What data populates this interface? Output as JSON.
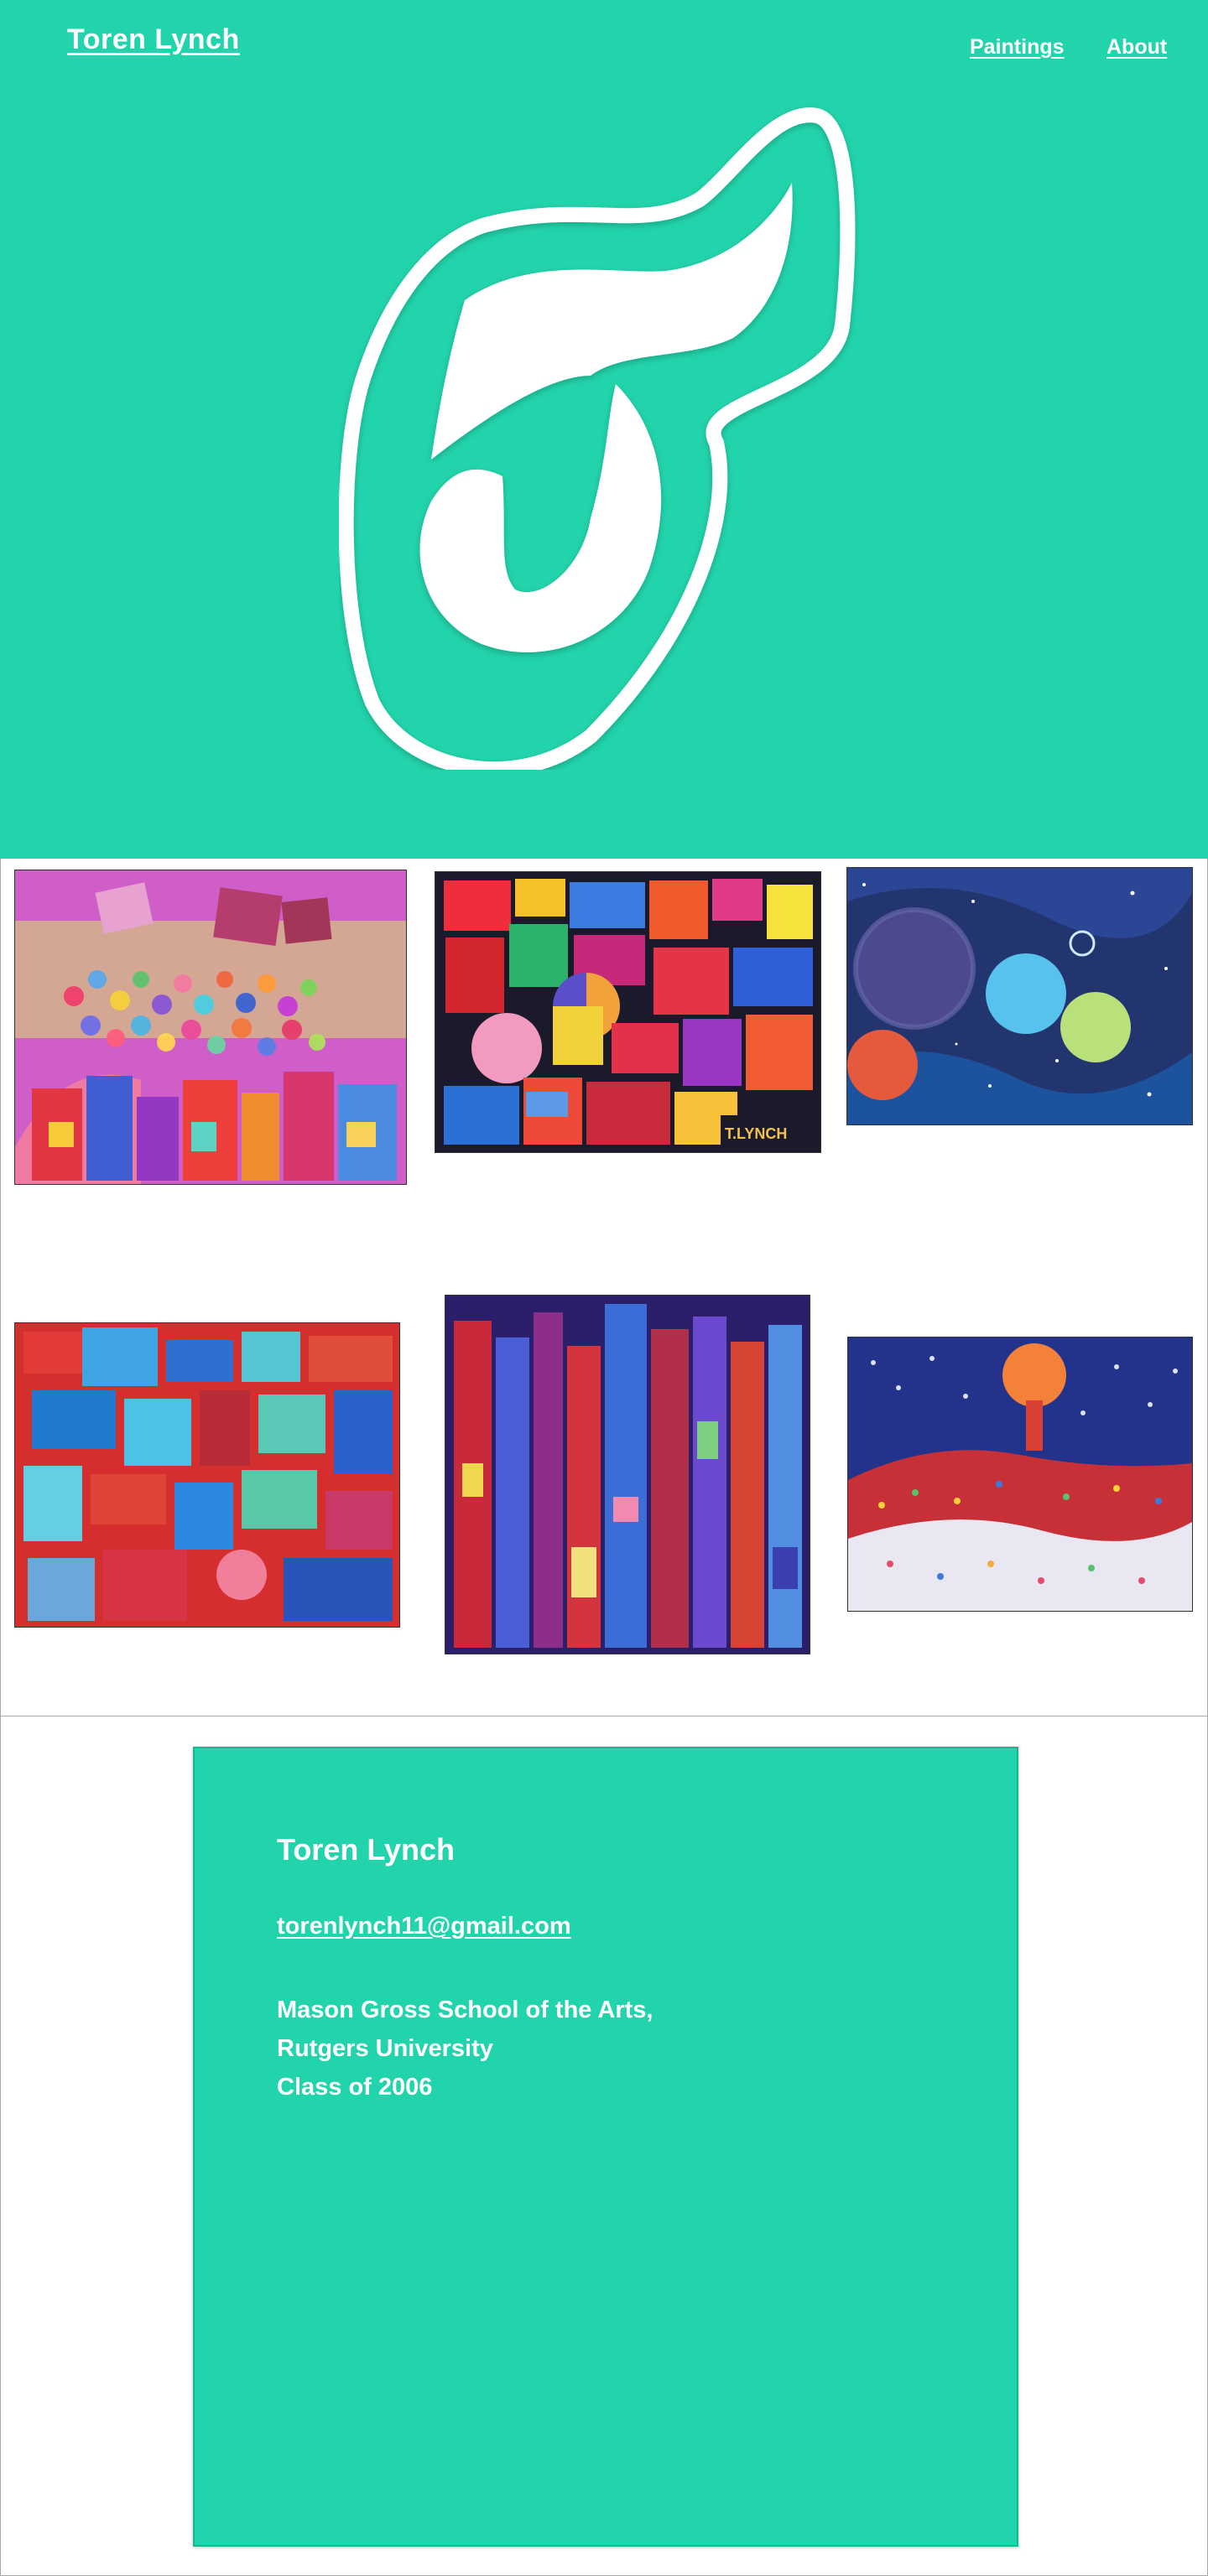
{
  "header": {
    "title": "Toren Lynch",
    "nav": [
      {
        "label": "Paintings"
      },
      {
        "label": "About"
      }
    ],
    "logo_icon": "stylized-T-monogram-icon"
  },
  "colors": {
    "accent": "#22d4ab",
    "card_border": "#1bb591",
    "text": "#ffffff",
    "divider": "#a8a8a8"
  },
  "gallery": {
    "paintings": [
      {
        "icon": "painting-candy-cityscape"
      },
      {
        "icon": "painting-geometric-blocks"
      },
      {
        "icon": "painting-planets"
      },
      {
        "icon": "painting-blue-red-abstract"
      },
      {
        "icon": "painting-vertical-city"
      },
      {
        "icon": "painting-dotted-landscape"
      }
    ]
  },
  "contact": {
    "name": "Toren Lynch",
    "email": "torenlynch11@gmail.com",
    "school_lines": [
      "Mason Gross School of the Arts,",
      "Rutgers University",
      "Class of 2006"
    ]
  }
}
